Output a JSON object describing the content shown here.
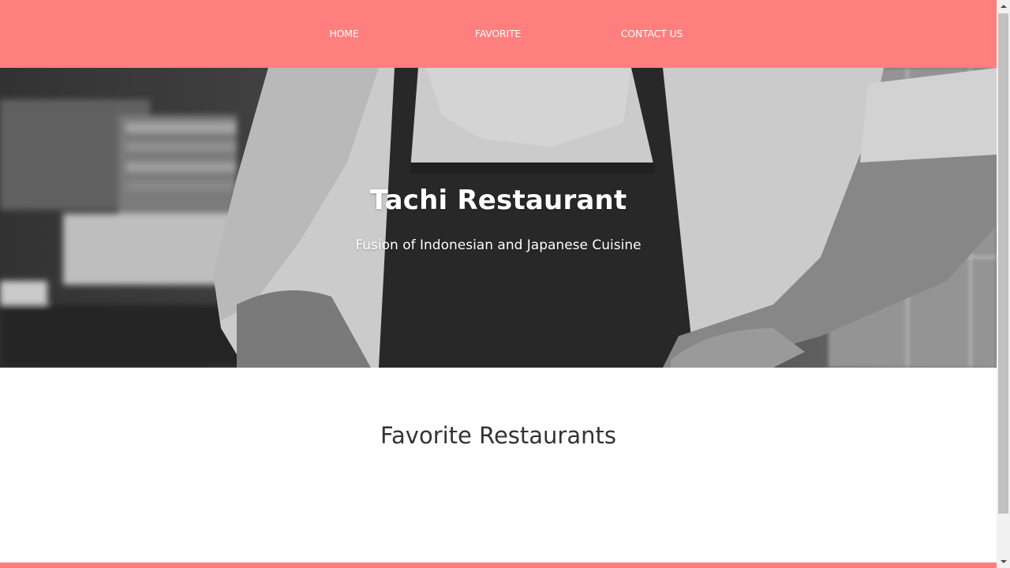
{
  "nav": {
    "items": [
      {
        "label": "HOME"
      },
      {
        "label": "FAVORITE"
      },
      {
        "label": "CONTACT US"
      }
    ]
  },
  "hero": {
    "title": "Tachi Restaurant",
    "subtitle": "Fusion of Indonesian and Japanese Cuisine",
    "image_icon": "chef-photo"
  },
  "favorites": {
    "title": "Favorite Restaurants",
    "items": []
  },
  "colors": {
    "accent": "#ff7f7f",
    "text_dark": "#333333",
    "text_light": "#ffffff"
  },
  "scrollbar": {
    "scroll_fraction": 0.0,
    "visible_fraction": 0.93
  }
}
